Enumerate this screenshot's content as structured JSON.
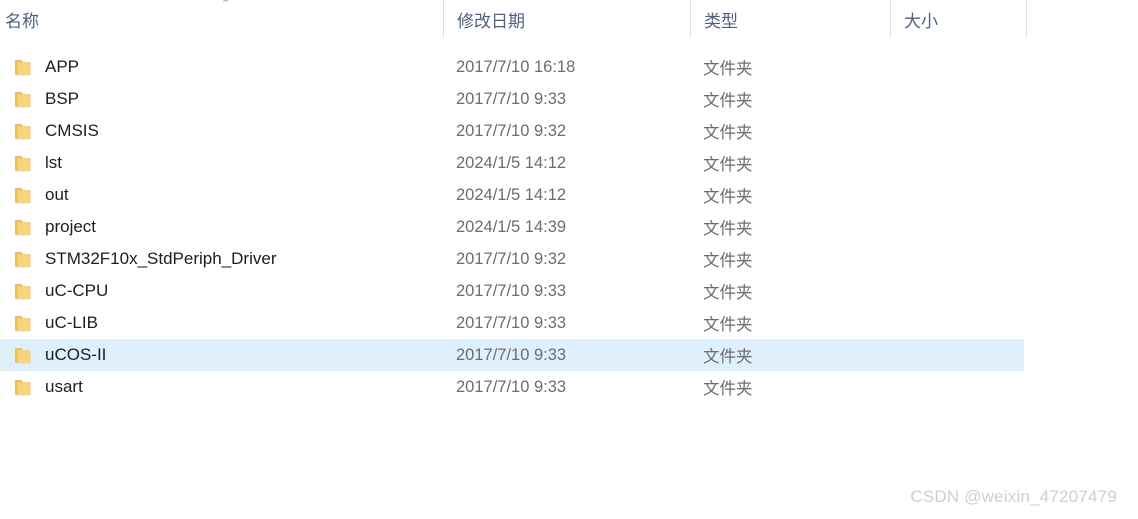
{
  "columns": {
    "name": "名称",
    "date_modified": "修改日期",
    "type": "类型",
    "size": "大小"
  },
  "sort": {
    "column": "名称",
    "direction": "ascending",
    "indicator_glyph": "⌃"
  },
  "colors": {
    "selection_background": "#dfeffc",
    "header_text": "#4d6182",
    "row_text": "#1d1d1d",
    "secondary_text": "#6d6d6d",
    "folder_body": "#f7d57f",
    "folder_tab": "#e9c05a",
    "divider": "#e2e2e2",
    "watermark_text": "#cfcfcf"
  },
  "rows": [
    {
      "name": "APP",
      "date": "2017/7/10 16:18",
      "type": "文件夹",
      "size": "",
      "selected": false
    },
    {
      "name": "BSP",
      "date": "2017/7/10 9:33",
      "type": "文件夹",
      "size": "",
      "selected": false
    },
    {
      "name": "CMSIS",
      "date": "2017/7/10 9:32",
      "type": "文件夹",
      "size": "",
      "selected": false
    },
    {
      "name": "lst",
      "date": "2024/1/5 14:12",
      "type": "文件夹",
      "size": "",
      "selected": false
    },
    {
      "name": "out",
      "date": "2024/1/5 14:12",
      "type": "文件夹",
      "size": "",
      "selected": false
    },
    {
      "name": "project",
      "date": "2024/1/5 14:39",
      "type": "文件夹",
      "size": "",
      "selected": false
    },
    {
      "name": "STM32F10x_StdPeriph_Driver",
      "date": "2017/7/10 9:32",
      "type": "文件夹",
      "size": "",
      "selected": false
    },
    {
      "name": "uC-CPU",
      "date": "2017/7/10 9:33",
      "type": "文件夹",
      "size": "",
      "selected": false
    },
    {
      "name": "uC-LIB",
      "date": "2017/7/10 9:33",
      "type": "文件夹",
      "size": "",
      "selected": false
    },
    {
      "name": "uCOS-II",
      "date": "2017/7/10 9:33",
      "type": "文件夹",
      "size": "",
      "selected": true
    },
    {
      "name": "usart",
      "date": "2017/7/10 9:33",
      "type": "文件夹",
      "size": "",
      "selected": false
    }
  ],
  "watermark": {
    "text": "CSDN @weixin_47207479"
  }
}
